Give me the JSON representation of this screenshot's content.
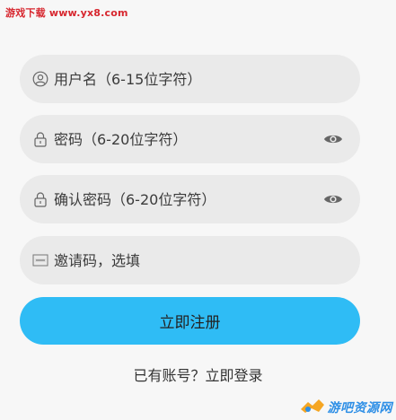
{
  "watermark": {
    "text": "游戏下载 www.yx8.com"
  },
  "form": {
    "username": {
      "placeholder": "用户名（6-15位字符）",
      "icon": "user-icon"
    },
    "password": {
      "placeholder": "密码（6-20位字符）",
      "icon": "lock-icon",
      "toggle_icon": "eye-icon"
    },
    "confirm_password": {
      "placeholder": "确认密码（6-20位字符）",
      "icon": "lock-icon",
      "toggle_icon": "eye-icon"
    },
    "invite_code": {
      "placeholder": "邀请码，选填",
      "icon": "abc-keyboard-icon"
    },
    "submit_label": "立即注册"
  },
  "footer": {
    "prompt": "已有账号？",
    "login_label": "立即登录"
  },
  "brand": {
    "text": "游吧资源网",
    "logo_icon": "logo-icon"
  },
  "colors": {
    "accent": "#2fbcf5",
    "field_bg": "#eaeaea",
    "page_bg": "#f7f7f7"
  }
}
